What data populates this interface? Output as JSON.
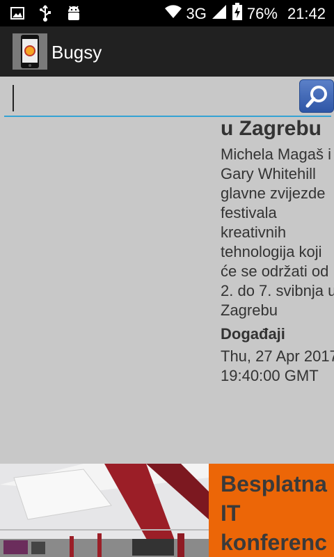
{
  "status_bar": {
    "network": "3G",
    "battery": "76%",
    "time": "21:42"
  },
  "app": {
    "title": "Bugsy"
  },
  "search": {
    "value": "",
    "placeholder": ""
  },
  "article": {
    "headline_visible": "u Zagrebu",
    "description": " Michela Magaš i Gary Whitehill glavne zvijezde festivala kreativnih tehnologija koji će se održati od 2. do 7. svibnja u Zagrebu",
    "category": "Događaji",
    "date": "Thu, 27 Apr 2017 19:40:00 GMT"
  },
  "next_article": {
    "title_line1": "Besplatna",
    "title_line2": "IT",
    "title_line3": "konferenc"
  },
  "colors": {
    "accent": "#33a3d4",
    "orange": "#ec6607"
  }
}
